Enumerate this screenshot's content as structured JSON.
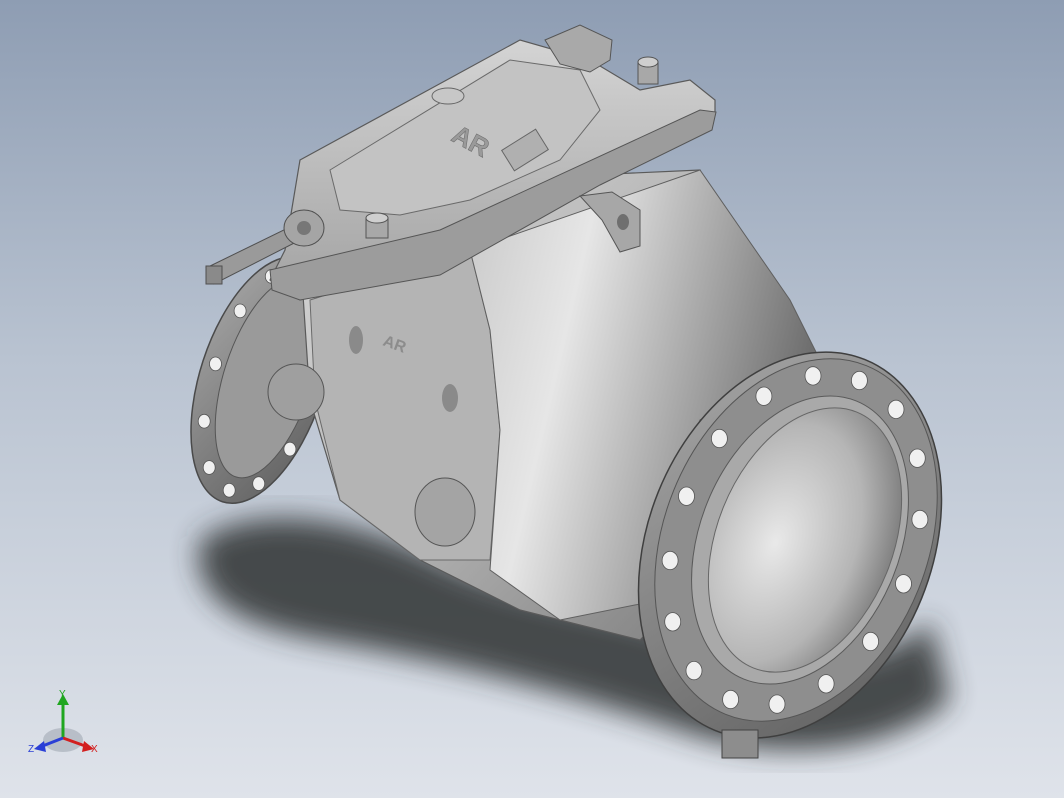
{
  "viewport": {
    "background_top": "#8e9db3",
    "background_bottom": "#dfe3ea"
  },
  "model": {
    "logo_text_top": "AR",
    "logo_text_side": "AR",
    "body_color": "#b9b9b9",
    "flange_color": "#8a8a8a",
    "shadow_color": "#2e3033"
  },
  "triad": {
    "x_label": "X",
    "y_label": "Y",
    "z_label": "Z",
    "x_color": "#d21f1f",
    "y_color": "#1fa61f",
    "z_color": "#2a3fd6"
  }
}
